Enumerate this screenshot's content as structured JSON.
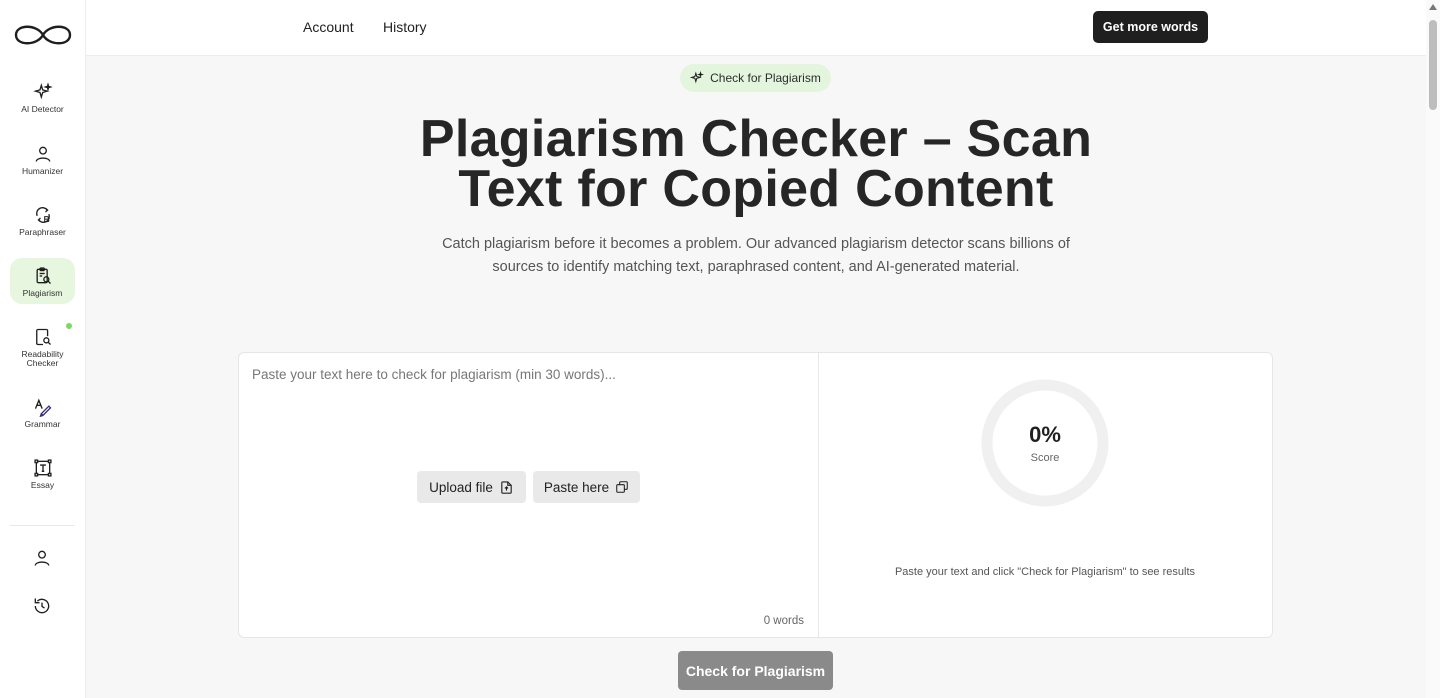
{
  "header": {
    "links": [
      "Account",
      "History"
    ],
    "cta_label": "Get more words"
  },
  "sidebar": {
    "items": [
      {
        "label": "AI Detector",
        "icon": "sparkle-icon",
        "active": false
      },
      {
        "label": "Humanizer",
        "icon": "person-icon",
        "active": false
      },
      {
        "label": "Paraphraser",
        "icon": "paraphrase-icon",
        "active": false
      },
      {
        "label": "Plagiarism",
        "icon": "clipboard-search-icon",
        "active": true
      },
      {
        "label": "Readability Checker",
        "icon": "document-search-icon",
        "active": false,
        "badge": "new"
      },
      {
        "label": "Grammar",
        "icon": "grammar-icon",
        "active": false
      },
      {
        "label": "Essay",
        "icon": "text-frame-icon",
        "active": false
      }
    ],
    "bottom_icons": [
      "user-icon",
      "history-icon"
    ]
  },
  "hero": {
    "pill_label": "Check for Plagiarism",
    "title": "Plagiarism Checker – Scan Text for Copied Content",
    "subtitle": "Catch plagiarism before it becomes a problem. Our advanced plagiarism detector scans billions of sources to identify matching text, paraphrased content, and AI-generated material."
  },
  "editor": {
    "placeholder": "Paste your text here to check for plagiarism (min 30 words)...",
    "upload_label": "Upload file",
    "paste_label": "Paste here",
    "word_count": "0 words"
  },
  "result": {
    "score_value": "0%",
    "score_label": "Score",
    "hint": "Paste your text and click \"Check for Plagiarism\" to see results"
  },
  "action": {
    "check_label": "Check for Plagiarism"
  },
  "colors": {
    "accent_light": "#e3f5dc",
    "primary_dark": "#1f1f1f",
    "disabled_button": "#8a8a8a"
  }
}
